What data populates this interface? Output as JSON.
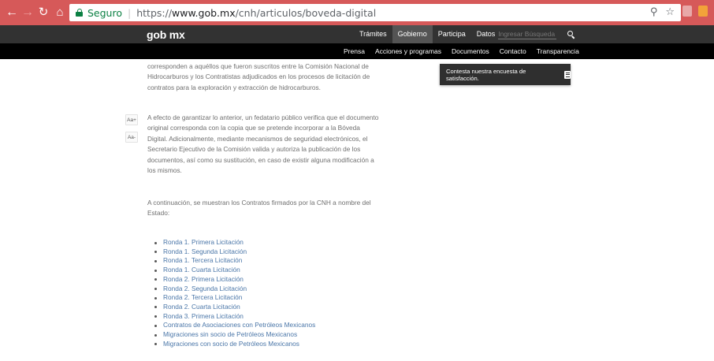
{
  "browser": {
    "secure_label": "Seguro",
    "url_scheme": "https://",
    "url_host": "www.gob.mx",
    "url_path": "/cnh/articulos/boveda-digital",
    "icons": [
      "back-icon",
      "forward-icon",
      "reload-icon",
      "home-icon",
      "lock-icon",
      "zoom-icon",
      "star-icon",
      "extension-icon",
      "menu-icon"
    ],
    "colors": {
      "frame": "#d65959",
      "secure": "#0b8043"
    }
  },
  "gob_header": {
    "logo": "gob mx",
    "nav": [
      "Trámites",
      "Gobierno",
      "Participa",
      "Datos"
    ],
    "active_nav": "Gobierno",
    "search_placeholder": "Ingresar Búsqueda",
    "colors": {
      "bar": "#323232",
      "active": "#545454"
    }
  },
  "sub_nav": [
    "Prensa",
    "Acciones y programas",
    "Documentos",
    "Contacto",
    "Transparencia"
  ],
  "font_tools": {
    "increase": "Aa+",
    "decrease": "Aa-"
  },
  "survey_banner": {
    "text": "Contesta nuestra encuesta de satisfacción."
  },
  "article": {
    "para1_lines": [
      "corresponden a aquéllos que fueron suscritos entre la Comisión Nacional de",
      "Hidrocarburos y los Contratistas adjudicados en los procesos de licitación de",
      "contratos para la exploración y extracción de hidrocarburos."
    ],
    "para2_lines": [
      "A efecto de garantizar lo anterior, un fedatario público verifica que el documento",
      "original corresponda con la copia que se pretende incorporar a la Bóveda",
      "Digital. Adicionalmente, mediante mecanismos de seguridad electrónicos, el",
      "Secretario Ejecutivo de la Comisión valida y autoriza la publicación de los",
      "documentos, así como su sustitución, en caso de existir alguna modificación a",
      "los mismos."
    ],
    "para3_lines": [
      "A continuación, se muestran los Contratos firmados por la CNH a nombre del",
      "Estado:"
    ],
    "links": [
      "Ronda 1. Primera Licitación",
      "Ronda 1. Segunda Licitación",
      "Ronda 1. Tercera Licitación",
      "Ronda 1. Cuarta Licitación",
      "Ronda 2. Primera Licitación",
      "Ronda 2. Segunda Licitación",
      "Ronda 2. Tercera Licitación",
      "Ronda 2. Cuarta Licitación",
      "Ronda 3. Primera Licitación",
      "Contratos de Asociaciones con Petróleos Mexicanos",
      "Migraciones sin socio de Petróleos Mexicanos",
      "Migraciones con socio de Petróleos Mexicanos"
    ],
    "colors": {
      "text": "#6f6f6f",
      "link": "#4a76a8"
    }
  }
}
